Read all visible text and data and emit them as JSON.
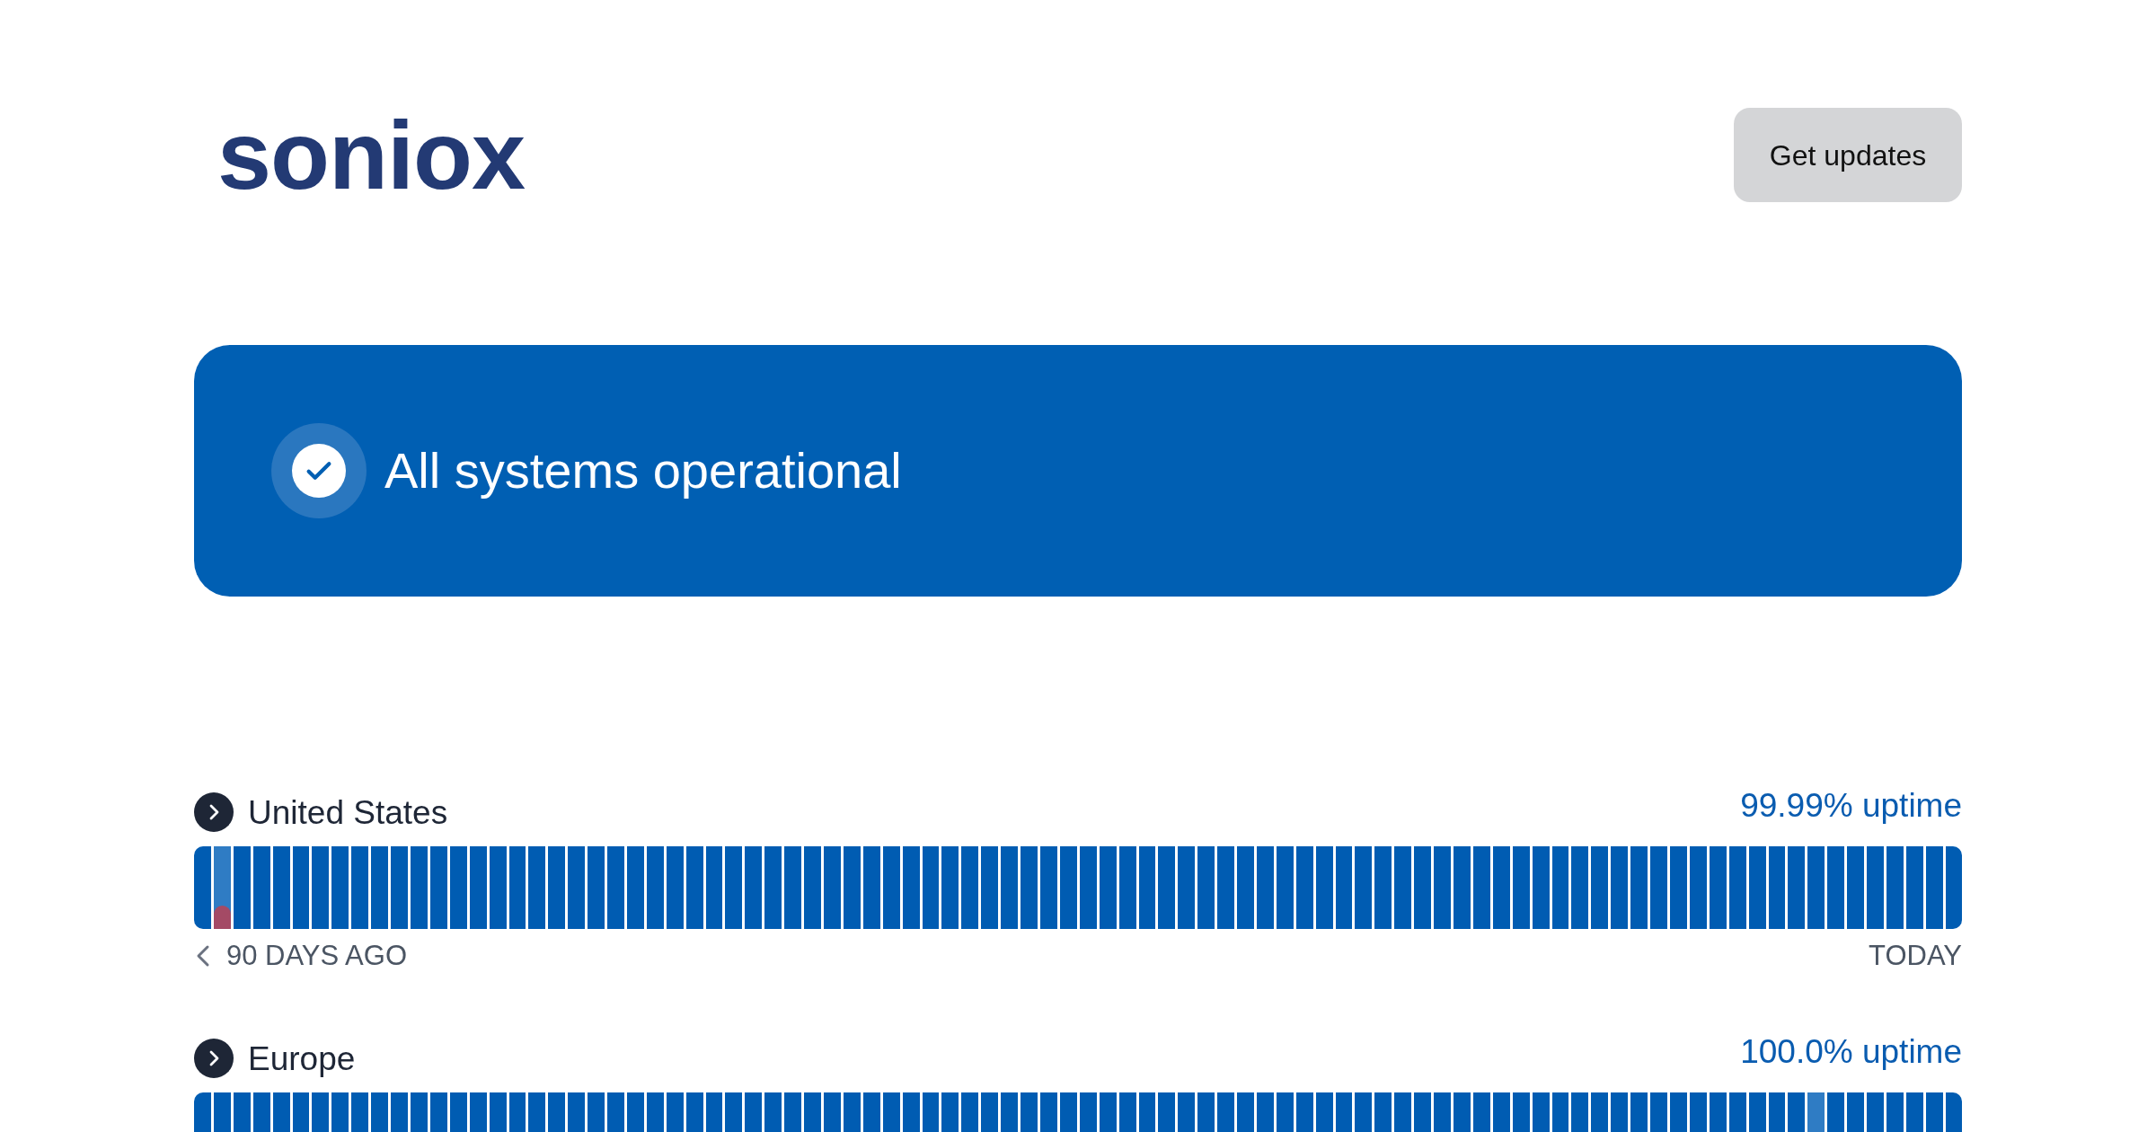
{
  "header": {
    "logo": "soniox",
    "button": "Get updates"
  },
  "banner": {
    "kind": "operational",
    "text": "All systems operational"
  },
  "regions": [
    {
      "name": "United States",
      "expanded": false,
      "uptime": "99.99% uptime",
      "start_label": "90 DAYS AGO",
      "end_label": "TODAY",
      "days": [
        {
          "kind": "up"
        },
        {
          "kind": "partial"
        },
        {
          "kind": "up"
        },
        {
          "kind": "up"
        },
        {
          "kind": "up"
        },
        {
          "kind": "up"
        },
        {
          "kind": "up"
        },
        {
          "kind": "up"
        },
        {
          "kind": "up"
        },
        {
          "kind": "up"
        },
        {
          "kind": "up"
        },
        {
          "kind": "up"
        },
        {
          "kind": "up"
        },
        {
          "kind": "up"
        },
        {
          "kind": "up"
        },
        {
          "kind": "up"
        },
        {
          "kind": "up"
        },
        {
          "kind": "up"
        },
        {
          "kind": "up"
        },
        {
          "kind": "up"
        },
        {
          "kind": "up"
        },
        {
          "kind": "up"
        },
        {
          "kind": "up"
        },
        {
          "kind": "up"
        },
        {
          "kind": "up"
        },
        {
          "kind": "up"
        },
        {
          "kind": "up"
        },
        {
          "kind": "up"
        },
        {
          "kind": "up"
        },
        {
          "kind": "up"
        },
        {
          "kind": "up"
        },
        {
          "kind": "up"
        },
        {
          "kind": "up"
        },
        {
          "kind": "up"
        },
        {
          "kind": "up"
        },
        {
          "kind": "up"
        },
        {
          "kind": "up"
        },
        {
          "kind": "up"
        },
        {
          "kind": "up"
        },
        {
          "kind": "up"
        },
        {
          "kind": "up"
        },
        {
          "kind": "up"
        },
        {
          "kind": "up"
        },
        {
          "kind": "up"
        },
        {
          "kind": "up"
        },
        {
          "kind": "up"
        },
        {
          "kind": "up"
        },
        {
          "kind": "up"
        },
        {
          "kind": "up"
        },
        {
          "kind": "up"
        },
        {
          "kind": "up"
        },
        {
          "kind": "up"
        },
        {
          "kind": "up"
        },
        {
          "kind": "up"
        },
        {
          "kind": "up"
        },
        {
          "kind": "up"
        },
        {
          "kind": "up"
        },
        {
          "kind": "up"
        },
        {
          "kind": "up"
        },
        {
          "kind": "up"
        },
        {
          "kind": "up"
        },
        {
          "kind": "up"
        },
        {
          "kind": "up"
        },
        {
          "kind": "up"
        },
        {
          "kind": "up"
        },
        {
          "kind": "up"
        },
        {
          "kind": "up"
        },
        {
          "kind": "up"
        },
        {
          "kind": "up"
        },
        {
          "kind": "up"
        },
        {
          "kind": "up"
        },
        {
          "kind": "up"
        },
        {
          "kind": "up"
        },
        {
          "kind": "up"
        },
        {
          "kind": "up"
        },
        {
          "kind": "up"
        },
        {
          "kind": "up"
        },
        {
          "kind": "up"
        },
        {
          "kind": "up"
        },
        {
          "kind": "up"
        },
        {
          "kind": "up"
        },
        {
          "kind": "up"
        },
        {
          "kind": "up"
        },
        {
          "kind": "up"
        },
        {
          "kind": "up"
        },
        {
          "kind": "up"
        },
        {
          "kind": "up"
        },
        {
          "kind": "up"
        },
        {
          "kind": "up"
        },
        {
          "kind": "up"
        }
      ]
    },
    {
      "name": "Europe",
      "expanded": false,
      "uptime": "100.0% uptime",
      "days": [
        {
          "kind": "up"
        },
        {
          "kind": "up"
        },
        {
          "kind": "up"
        },
        {
          "kind": "up"
        },
        {
          "kind": "up"
        },
        {
          "kind": "up"
        },
        {
          "kind": "up"
        },
        {
          "kind": "up"
        },
        {
          "kind": "up"
        },
        {
          "kind": "up"
        },
        {
          "kind": "up"
        },
        {
          "kind": "up"
        },
        {
          "kind": "up"
        },
        {
          "kind": "up"
        },
        {
          "kind": "up"
        },
        {
          "kind": "up"
        },
        {
          "kind": "up"
        },
        {
          "kind": "up"
        },
        {
          "kind": "up"
        },
        {
          "kind": "up"
        },
        {
          "kind": "up"
        },
        {
          "kind": "up"
        },
        {
          "kind": "up"
        },
        {
          "kind": "up"
        },
        {
          "kind": "up"
        },
        {
          "kind": "up"
        },
        {
          "kind": "up"
        },
        {
          "kind": "up"
        },
        {
          "kind": "up"
        },
        {
          "kind": "up"
        },
        {
          "kind": "up"
        },
        {
          "kind": "up"
        },
        {
          "kind": "up"
        },
        {
          "kind": "up"
        },
        {
          "kind": "up"
        },
        {
          "kind": "up"
        },
        {
          "kind": "up"
        },
        {
          "kind": "up"
        },
        {
          "kind": "up"
        },
        {
          "kind": "up"
        },
        {
          "kind": "up"
        },
        {
          "kind": "up"
        },
        {
          "kind": "up"
        },
        {
          "kind": "up"
        },
        {
          "kind": "up"
        },
        {
          "kind": "up"
        },
        {
          "kind": "up"
        },
        {
          "kind": "up"
        },
        {
          "kind": "up"
        },
        {
          "kind": "up"
        },
        {
          "kind": "up"
        },
        {
          "kind": "up"
        },
        {
          "kind": "up"
        },
        {
          "kind": "up"
        },
        {
          "kind": "up"
        },
        {
          "kind": "up"
        },
        {
          "kind": "up"
        },
        {
          "kind": "up"
        },
        {
          "kind": "up"
        },
        {
          "kind": "up"
        },
        {
          "kind": "up"
        },
        {
          "kind": "up"
        },
        {
          "kind": "up"
        },
        {
          "kind": "up"
        },
        {
          "kind": "up"
        },
        {
          "kind": "up"
        },
        {
          "kind": "up"
        },
        {
          "kind": "up"
        },
        {
          "kind": "up"
        },
        {
          "kind": "up"
        },
        {
          "kind": "up"
        },
        {
          "kind": "up"
        },
        {
          "kind": "up"
        },
        {
          "kind": "up"
        },
        {
          "kind": "up"
        },
        {
          "kind": "up"
        },
        {
          "kind": "up"
        },
        {
          "kind": "up"
        },
        {
          "kind": "up"
        },
        {
          "kind": "up"
        },
        {
          "kind": "up"
        },
        {
          "kind": "up"
        },
        {
          "kind": "minor"
        },
        {
          "kind": "up"
        },
        {
          "kind": "up"
        },
        {
          "kind": "up"
        },
        {
          "kind": "up"
        },
        {
          "kind": "up"
        },
        {
          "kind": "up"
        },
        {
          "kind": "up"
        }
      ]
    }
  ]
}
